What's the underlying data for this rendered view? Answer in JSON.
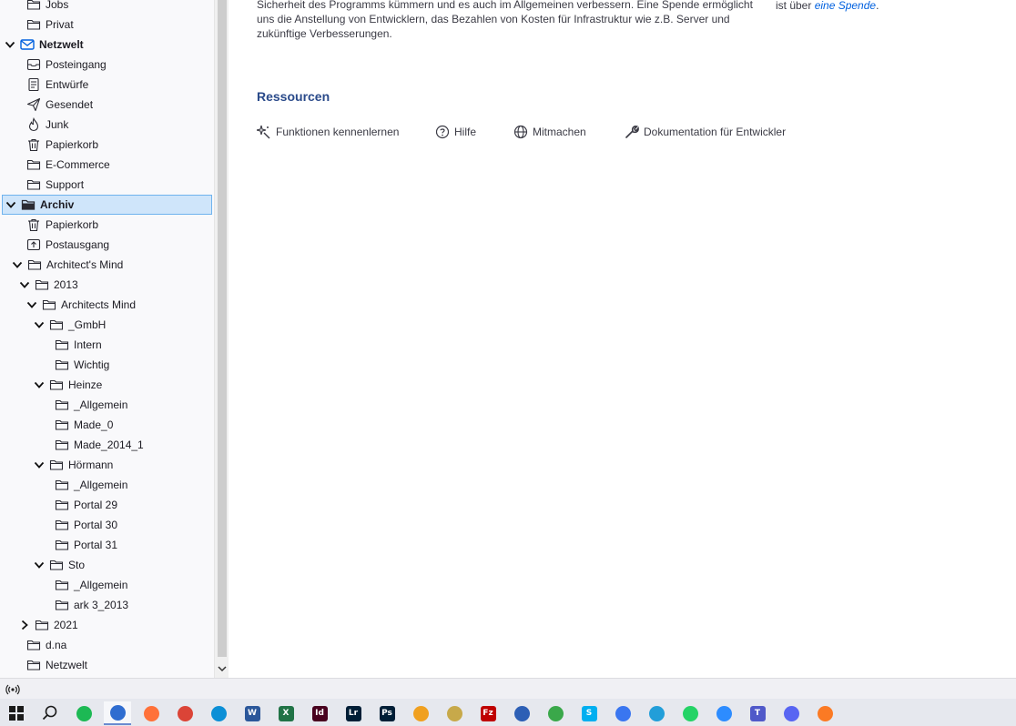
{
  "folder_tree": {
    "items": [
      {
        "label": "Jobs",
        "icon": "folder-icon",
        "twisty": "",
        "indent": 0
      },
      {
        "label": "Privat",
        "icon": "folder-icon",
        "twisty": "",
        "indent": 0
      },
      {
        "label": "Netzwelt",
        "icon": "mail-account-icon",
        "twisty": "expanded",
        "indent": -1,
        "bold": true
      },
      {
        "label": "Posteingang",
        "icon": "inbox-icon",
        "twisty": "",
        "indent": 0
      },
      {
        "label": "Entwürfe",
        "icon": "drafts-icon",
        "twisty": "",
        "indent": 0
      },
      {
        "label": "Gesendet",
        "icon": "sent-icon",
        "twisty": "",
        "indent": 0
      },
      {
        "label": "Junk",
        "icon": "junk-icon",
        "twisty": "",
        "indent": 0
      },
      {
        "label": "Papierkorb",
        "icon": "trash-icon",
        "twisty": "",
        "indent": 0
      },
      {
        "label": "E-Commerce",
        "icon": "folder-icon",
        "twisty": "",
        "indent": 0
      },
      {
        "label": "Support",
        "icon": "folder-icon",
        "twisty": "",
        "indent": 0
      },
      {
        "label": "Archiv",
        "icon": "archive-folder-icon",
        "twisty": "expanded",
        "indent": -1,
        "bold": true,
        "selected": true
      },
      {
        "label": "Papierkorb",
        "icon": "trash-icon",
        "twisty": "",
        "indent": 0
      },
      {
        "label": "Postausgang",
        "icon": "outbox-icon",
        "twisty": "",
        "indent": 0
      },
      {
        "label": "Architect's Mind",
        "icon": "folder-icon",
        "twisty": "expanded",
        "indent": 0
      },
      {
        "label": "2013",
        "icon": "folder-icon",
        "twisty": "expanded",
        "indent": 1
      },
      {
        "label": "Architects Mind",
        "icon": "folder-icon",
        "twisty": "expanded",
        "indent": 2
      },
      {
        "label": "_GmbH",
        "icon": "folder-icon",
        "twisty": "expanded",
        "indent": 3
      },
      {
        "label": "Intern",
        "icon": "folder-icon",
        "twisty": "",
        "indent": 4
      },
      {
        "label": "Wichtig",
        "icon": "folder-icon",
        "twisty": "",
        "indent": 4
      },
      {
        "label": "Heinze",
        "icon": "folder-icon",
        "twisty": "expanded",
        "indent": 3
      },
      {
        "label": "_Allgemein",
        "icon": "folder-icon",
        "twisty": "",
        "indent": 4
      },
      {
        "label": "Made_0",
        "icon": "folder-icon",
        "twisty": "",
        "indent": 4
      },
      {
        "label": "Made_2014_1",
        "icon": "folder-icon",
        "twisty": "",
        "indent": 4
      },
      {
        "label": "Hörmann",
        "icon": "folder-icon",
        "twisty": "expanded",
        "indent": 3
      },
      {
        "label": "_Allgemein",
        "icon": "folder-icon",
        "twisty": "",
        "indent": 4
      },
      {
        "label": "Portal 29",
        "icon": "folder-icon",
        "twisty": "",
        "indent": 4
      },
      {
        "label": "Portal 30",
        "icon": "folder-icon",
        "twisty": "",
        "indent": 4
      },
      {
        "label": "Portal 31",
        "icon": "folder-icon",
        "twisty": "",
        "indent": 4
      },
      {
        "label": "Sto",
        "icon": "folder-icon",
        "twisty": "expanded",
        "indent": 3
      },
      {
        "label": "_Allgemein",
        "icon": "folder-icon",
        "twisty": "",
        "indent": 4
      },
      {
        "label": "ark 3_2013",
        "icon": "folder-icon",
        "twisty": "",
        "indent": 4
      },
      {
        "label": "2021",
        "icon": "folder-icon",
        "twisty": "collapsed",
        "indent": 1
      },
      {
        "label": "d.na",
        "icon": "folder-icon",
        "twisty": "",
        "indent": 0
      },
      {
        "label": "Netzwelt",
        "icon": "folder-icon",
        "twisty": "",
        "indent": 0
      }
    ]
  },
  "main": {
    "intro_text": "Sicherheit des Programms kümmern und es auch im Allgemeinen verbessern. Eine Spende ermöglicht uns die Anstellung von Entwicklern, das Bezahlen von Kosten für Infrastruktur wie z.B. Server und zukünftige Verbesserungen.",
    "donate_prefix": "ist über ",
    "donate_link": "eine Spende",
    "donate_suffix": ".",
    "resources_heading": "Ressourcen",
    "resources": [
      {
        "label": "Funktionen kennenlernen",
        "icon": "sparkle-icon"
      },
      {
        "label": "Hilfe",
        "icon": "help-icon"
      },
      {
        "label": "Mitmachen",
        "icon": "globe-icon"
      },
      {
        "label": "Dokumentation für Entwickler",
        "icon": "wrench-icon"
      }
    ]
  },
  "statusbar": {
    "icon": "online-status-icon"
  },
  "taskbar": {
    "apps": [
      {
        "name": "start-button",
        "color": "#1a1a1a"
      },
      {
        "name": "search-button",
        "color": "#1a1a1a"
      },
      {
        "name": "spotify",
        "color": "#1db954"
      },
      {
        "name": "thunderbird",
        "color": "#2f6dd0"
      },
      {
        "name": "firefox",
        "color": "#ff7139"
      },
      {
        "name": "chrome",
        "color": "#db4437"
      },
      {
        "name": "edge",
        "color": "#0c8fd6"
      },
      {
        "name": "word",
        "color": "#2b579a",
        "text": "W"
      },
      {
        "name": "excel",
        "color": "#217346",
        "text": "X"
      },
      {
        "name": "indesign",
        "color": "#49021f",
        "text": "Id"
      },
      {
        "name": "lightroom",
        "color": "#001e36",
        "text": "Lr"
      },
      {
        "name": "photoshop",
        "color": "#001e36",
        "text": "Ps"
      },
      {
        "name": "nav-app",
        "color": "#f0a020"
      },
      {
        "name": "notepad",
        "color": "#c7a94a"
      },
      {
        "name": "filezilla",
        "color": "#bf0000",
        "text": "Fz"
      },
      {
        "name": "app-blue",
        "color": "#2d5fb5"
      },
      {
        "name": "sync-app",
        "color": "#3aa84a"
      },
      {
        "name": "skype",
        "color": "#00aff0",
        "text": "S"
      },
      {
        "name": "signal",
        "color": "#3a76f0"
      },
      {
        "name": "telegram",
        "color": "#229ed9"
      },
      {
        "name": "whatsapp",
        "color": "#25d366"
      },
      {
        "name": "zoom",
        "color": "#2d8cff"
      },
      {
        "name": "teams",
        "color": "#5059c9",
        "text": "T"
      },
      {
        "name": "discord",
        "color": "#5865f2"
      },
      {
        "name": "xampp",
        "color": "#fb7a24"
      }
    ]
  }
}
